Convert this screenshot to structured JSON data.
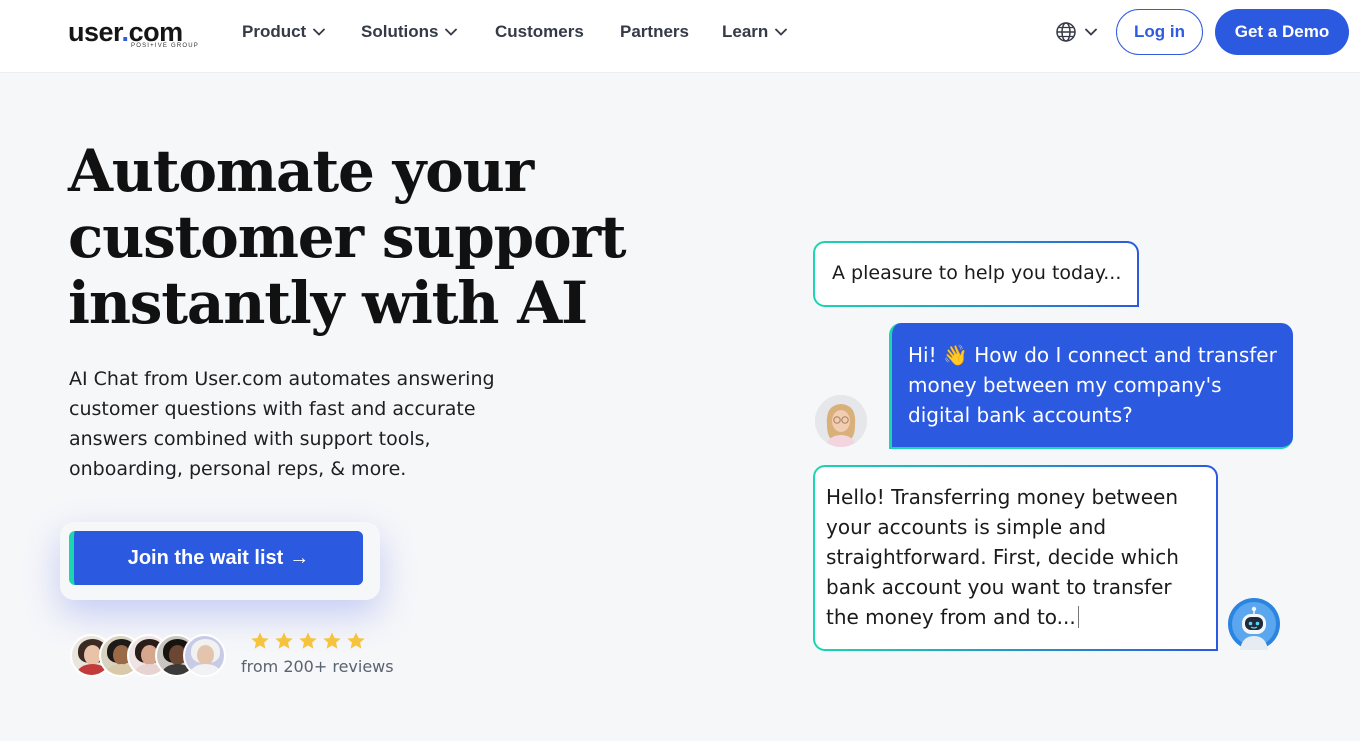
{
  "brand": {
    "name_part1": "user",
    "name_dot": ".",
    "name_part2": "com",
    "tagline": "POSI+IVE GROUP",
    "accent_color": "#2b59e0",
    "teal_color": "#1bd6b0"
  },
  "nav": {
    "items": [
      {
        "label": "Product",
        "has_dropdown": true
      },
      {
        "label": "Solutions",
        "has_dropdown": true
      },
      {
        "label": "Customers",
        "has_dropdown": false
      },
      {
        "label": "Partners",
        "has_dropdown": false
      },
      {
        "label": "Learn",
        "has_dropdown": true
      }
    ],
    "language_icon": "globe-icon",
    "login_label": "Log in",
    "demo_label": "Get a Demo"
  },
  "hero": {
    "title_line1": "Automate your",
    "title_line2": "customer support",
    "title_line3": "instantly with AI",
    "description": "AI Chat from User.com automates answering customer questions with fast and accurate answers combined with support tools, onboarding, personal reps, & more.",
    "cta_label": "Join the wait list",
    "cta_arrow": "→",
    "rating_stars": 5,
    "reviews_text": "from 200+ reviews"
  },
  "chat": {
    "bot_greeting": "A pleasure to help you today...",
    "user_message": "Hi! 👋 How do I connect and transfer money between my company's digital bank accounts?",
    "bot_reply": "Hello! Transferring money between your accounts is simple and straightforward. First, decide which bank account you want to transfer the money from and to..."
  }
}
